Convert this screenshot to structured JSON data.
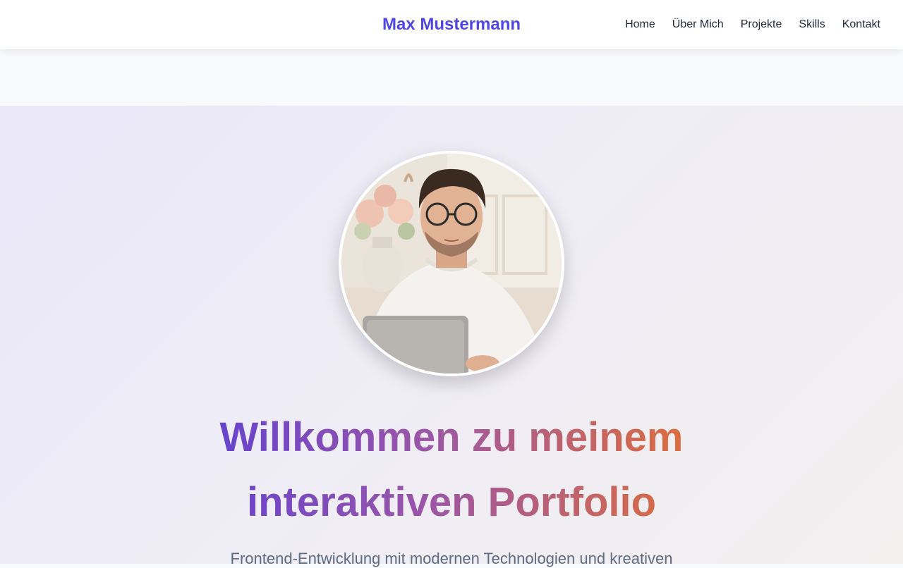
{
  "navbar": {
    "brand": "Max Mustermann",
    "links": [
      "Home",
      "Über Mich",
      "Projekte",
      "Skills",
      "Kontakt"
    ]
  },
  "hero": {
    "avatar_icon": "profile-photo",
    "headline_line1": "Willkommen zu meinem",
    "headline_line2": "interaktiven Portfolio",
    "subtitle": "Frontend-Entwicklung mit modernen Technologien und kreativen"
  },
  "colors": {
    "brand": "#4f46e5",
    "gradient_start": "#5b3fd6",
    "gradient_end": "#e8712a"
  }
}
